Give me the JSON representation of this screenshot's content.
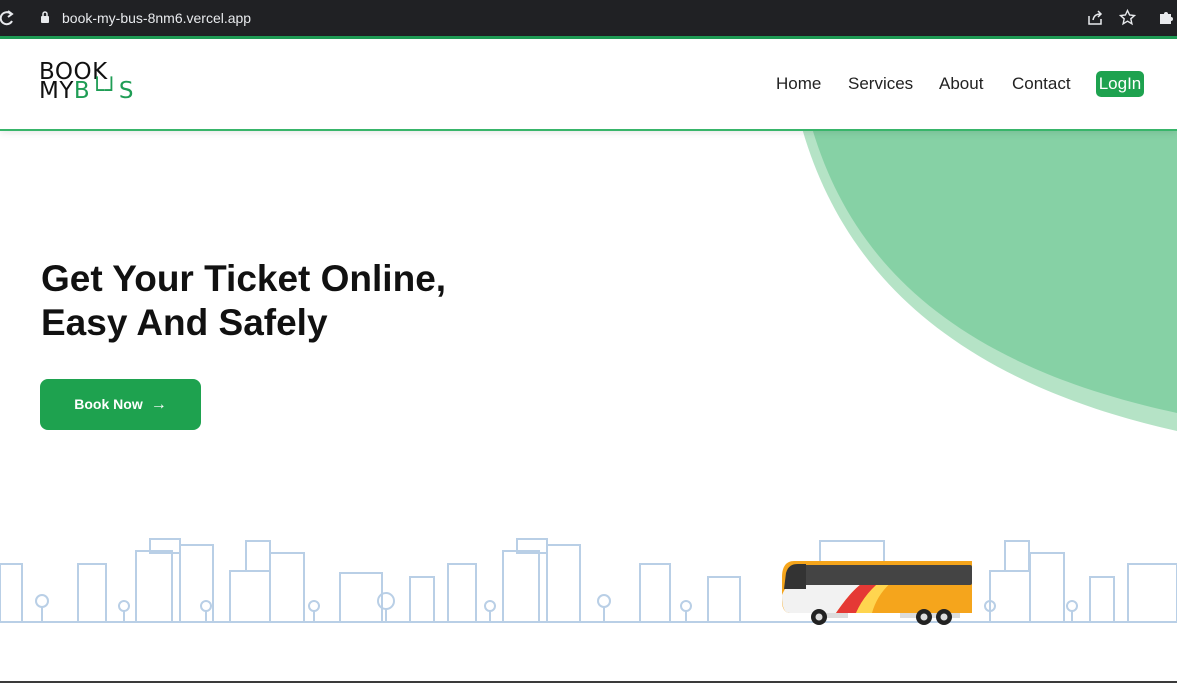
{
  "browser": {
    "url": "book-my-bus-8nm6.vercel.app"
  },
  "logo": {
    "line1": "BOOK",
    "line2_prefix": "MY",
    "line2_accent": "B└┘S"
  },
  "nav": {
    "items": [
      {
        "label": "Home"
      },
      {
        "label": "Services"
      },
      {
        "label": "About"
      },
      {
        "label": "Contact"
      }
    ],
    "login_label": "LogIn"
  },
  "hero": {
    "headline_line1": "Get Your Ticket Online,",
    "headline_line2": "Easy And Safely",
    "cta_label": "Book Now",
    "cta_arrow": "→"
  },
  "colors": {
    "brand_green": "#1ea24f",
    "blob_green": "#86d1a5",
    "city_blue": "#b9cfe6",
    "bus_orange": "#f5a51c"
  }
}
